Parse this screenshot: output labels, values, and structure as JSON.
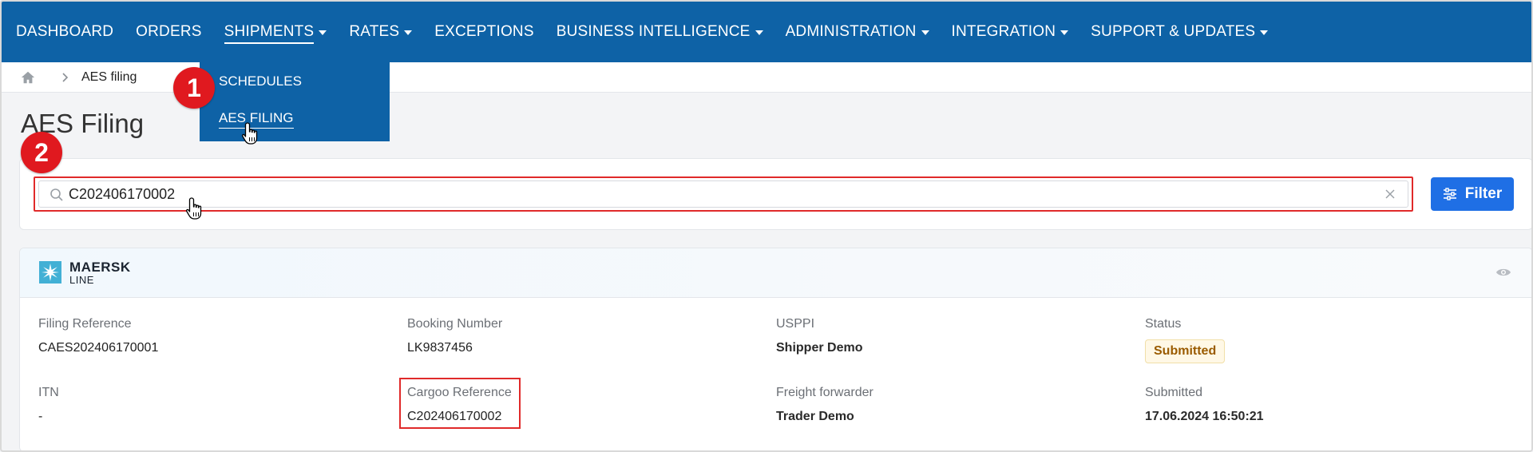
{
  "nav": {
    "items": [
      {
        "label": "DASHBOARD",
        "caret": false
      },
      {
        "label": "ORDERS",
        "caret": false
      },
      {
        "label": "SHIPMENTS",
        "caret": true
      },
      {
        "label": "RATES",
        "caret": true
      },
      {
        "label": "EXCEPTIONS",
        "caret": false
      },
      {
        "label": "BUSINESS INTELLIGENCE",
        "caret": true
      },
      {
        "label": "ADMINISTRATION",
        "caret": true
      },
      {
        "label": "INTEGRATION",
        "caret": true
      },
      {
        "label": "SUPPORT & UPDATES",
        "caret": true
      }
    ],
    "active": "SHIPMENTS"
  },
  "dropdown": {
    "items": [
      "SCHEDULES",
      "AES FILING"
    ]
  },
  "breadcrumb": {
    "current": "AES filing"
  },
  "page": {
    "title": "AES Filing"
  },
  "markers": [
    "1",
    "2"
  ],
  "search": {
    "value": "C202406170002",
    "filter_label": "Filter"
  },
  "card": {
    "brand": "MAERSK",
    "brand_sub": "LINE",
    "fields": {
      "filing_reference": {
        "label": "Filing Reference",
        "value": "CAES202406170001"
      },
      "booking_number": {
        "label": "Booking Number",
        "value": "LK9837456"
      },
      "usppi": {
        "label": "USPPI",
        "value": "Shipper Demo"
      },
      "status": {
        "label": "Status",
        "value": "Submitted"
      },
      "itn": {
        "label": "ITN",
        "value": "-"
      },
      "cargoo_reference": {
        "label": "Cargoo Reference",
        "value": "C202406170002"
      },
      "freight_forwarder": {
        "label": "Freight forwarder",
        "value": "Trader Demo"
      },
      "submitted": {
        "label": "Submitted",
        "value": "17.06.2024 16:50:21"
      }
    }
  },
  "colors": {
    "nav_bg": "#0e62a6",
    "accent": "#1f6fe5",
    "marker": "#e0191f",
    "highlight": "#e02a2a",
    "status_text": "#9a5b00",
    "brand_star": "#42b0d5"
  }
}
